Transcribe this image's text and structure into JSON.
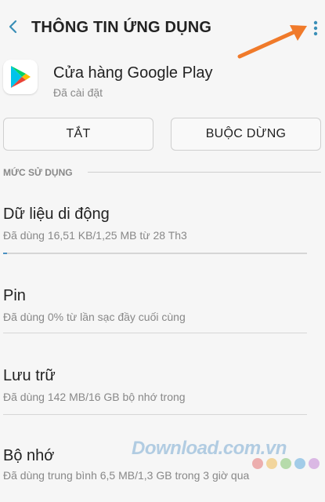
{
  "header": {
    "title": "THÔNG TIN ỨNG DỤNG"
  },
  "app": {
    "name": "Cửa hàng Google Play",
    "status": "Đã cài đặt"
  },
  "actions": {
    "disable_label": "TẮT",
    "force_stop_label": "BUỘC DỪNG"
  },
  "usage": {
    "section_label": "MỨC SỬ DỤNG",
    "items": [
      {
        "title": "Dữ liệu di động",
        "desc": "Đã dùng 16,51 KB/1,25 MB từ 28 Th3",
        "progress_fraction": 0.013
      },
      {
        "title": "Pin",
        "desc": "Đã dùng 0% từ lần sạc đầy cuối cùng"
      },
      {
        "title": "Lưu trữ",
        "desc": "Đã dùng 142 MB/16 GB bộ nhớ trong"
      },
      {
        "title": "Bộ nhớ",
        "desc": "Đã dùng trung bình 6,5 MB/1,3 GB trong 3 giờ qua"
      }
    ]
  },
  "watermark": {
    "text": "Download.com.vn",
    "dot_colors": [
      "#e67e7e",
      "#f0c060",
      "#8cc97a",
      "#6ab0e0",
      "#c890d8"
    ]
  },
  "colors": {
    "accent": "#4a90c2",
    "annotation_arrow": "#f07a2a",
    "background": "#f6f6f6"
  }
}
